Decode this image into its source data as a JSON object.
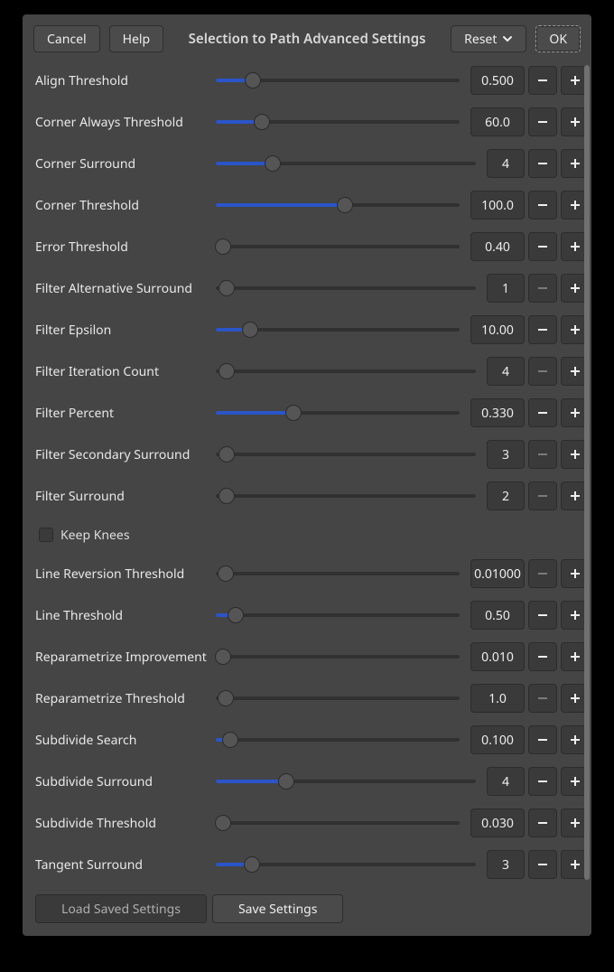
{
  "header": {
    "cancel": "Cancel",
    "help": "Help",
    "title": "Selection to Path Advanced Settings",
    "reset": "Reset",
    "ok": "OK"
  },
  "params": [
    {
      "id": "align-threshold",
      "label": "Align Threshold",
      "value": "0.500",
      "fill": 15,
      "narrow": false,
      "minusDisabled": false
    },
    {
      "id": "corner-always-threshold",
      "label": "Corner Always Threshold",
      "value": "60.0",
      "fill": 19,
      "narrow": false,
      "minusDisabled": false
    },
    {
      "id": "corner-surround",
      "label": "Corner Surround",
      "value": "4",
      "fill": 22,
      "narrow": true,
      "minusDisabled": false
    },
    {
      "id": "corner-threshold",
      "label": "Corner Threshold",
      "value": "100.0",
      "fill": 53,
      "narrow": false,
      "minusDisabled": false
    },
    {
      "id": "error-threshold",
      "label": "Error Threshold",
      "value": "0.40",
      "fill": 2,
      "narrow": false,
      "minusDisabled": false
    },
    {
      "id": "filter-alternative-surround",
      "label": "Filter Alternative Surround",
      "value": "1",
      "fill": 0,
      "narrow": true,
      "minusDisabled": true
    },
    {
      "id": "filter-epsilon",
      "label": "Filter Epsilon",
      "value": "10.00",
      "fill": 14,
      "narrow": false,
      "minusDisabled": false
    },
    {
      "id": "filter-iteration-count",
      "label": "Filter Iteration Count",
      "value": "4",
      "fill": 0,
      "narrow": true,
      "minusDisabled": true
    },
    {
      "id": "filter-percent",
      "label": "Filter Percent",
      "value": "0.330",
      "fill": 32,
      "narrow": false,
      "minusDisabled": false
    },
    {
      "id": "filter-secondary-surround",
      "label": "Filter Secondary Surround",
      "value": "3",
      "fill": 0,
      "narrow": true,
      "minusDisabled": true
    },
    {
      "id": "filter-surround",
      "label": "Filter Surround",
      "value": "2",
      "fill": 0,
      "narrow": true,
      "minusDisabled": true
    }
  ],
  "checkbox": {
    "label": "Keep Knees",
    "checked": false
  },
  "params2": [
    {
      "id": "line-reversion-threshold",
      "label": "Line Reversion Threshold",
      "value": "0.01000",
      "fill": 0,
      "narrow": false,
      "minusDisabled": true
    },
    {
      "id": "line-threshold",
      "label": "Line Threshold",
      "value": "0.50",
      "fill": 8,
      "narrow": false,
      "minusDisabled": false
    },
    {
      "id": "reparametrize-improvement",
      "label": "Reparametrize Improvement",
      "value": "0.010",
      "fill": 2,
      "narrow": false,
      "minusDisabled": false
    },
    {
      "id": "reparametrize-threshold",
      "label": "Reparametrize Threshold",
      "value": "1.0",
      "fill": 0,
      "narrow": false,
      "minusDisabled": true
    },
    {
      "id": "subdivide-search",
      "label": "Subdivide Search",
      "value": "0.100",
      "fill": 6,
      "narrow": false,
      "minusDisabled": false
    },
    {
      "id": "subdivide-surround",
      "label": "Subdivide Surround",
      "value": "4",
      "fill": 27,
      "narrow": true,
      "minusDisabled": false
    },
    {
      "id": "subdivide-threshold",
      "label": "Subdivide Threshold",
      "value": "0.030",
      "fill": 2,
      "narrow": false,
      "minusDisabled": false
    },
    {
      "id": "tangent-surround",
      "label": "Tangent Surround",
      "value": "3",
      "fill": 14,
      "narrow": true,
      "minusDisabled": false
    }
  ],
  "footer": {
    "load": "Load Saved Settings",
    "save": "Save Settings"
  }
}
